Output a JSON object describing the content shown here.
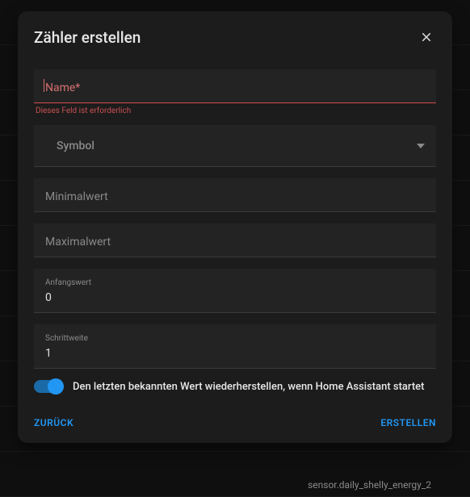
{
  "dialog": {
    "title": "Zähler erstellen",
    "close_icon": "close"
  },
  "fields": {
    "name": {
      "placeholder": "Name*",
      "error": "Dieses Feld ist erforderlich"
    },
    "symbol": {
      "placeholder": "Symbol"
    },
    "min": {
      "placeholder": "Minimalwert"
    },
    "max": {
      "placeholder": "Maximalwert"
    },
    "initial": {
      "label": "Anfangswert",
      "value": "0"
    },
    "step": {
      "label": "Schrittweite",
      "value": "1"
    }
  },
  "toggle": {
    "label": "Den letzten bekannten Wert wiederherstellen, wenn Home Assistant startet",
    "on": true
  },
  "actions": {
    "back": "ZURÜCK",
    "create": "ERSTELLEN"
  },
  "footer": "sensor.daily_shelly_energy_2"
}
